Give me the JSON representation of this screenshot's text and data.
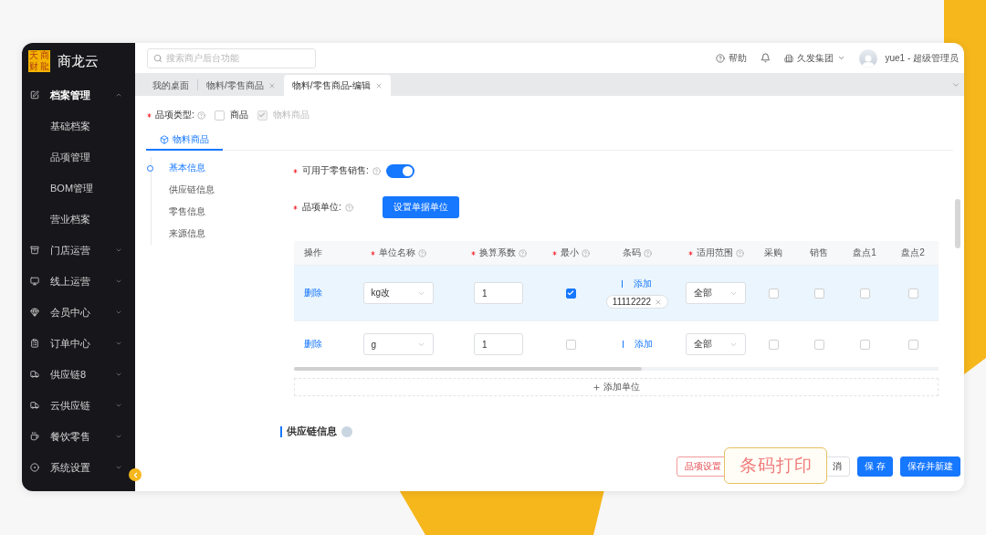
{
  "sidebar": {
    "logo": {
      "chars": [
        "天",
        "商",
        "财",
        "龍"
      ],
      "name": "商龙云"
    },
    "items": [
      {
        "label": "档案管理",
        "expanded": true,
        "children": [
          {
            "label": "基础档案"
          },
          {
            "label": "品项管理"
          },
          {
            "label": "BOM管理"
          },
          {
            "label": "营业档案"
          }
        ]
      },
      {
        "label": "门店运营",
        "expanded": false
      },
      {
        "label": "线上运营",
        "expanded": false
      },
      {
        "label": "会员中心",
        "expanded": false
      },
      {
        "label": "订单中心",
        "expanded": false
      },
      {
        "label": "供应链8",
        "expanded": false
      },
      {
        "label": "云供应链",
        "expanded": false
      },
      {
        "label": "餐饮零售",
        "expanded": false
      },
      {
        "label": "系统设置",
        "expanded": false
      }
    ]
  },
  "topbar": {
    "search": {
      "placeholder": "搜索商户后台功能"
    },
    "help": "帮助",
    "organization": "久发集团",
    "user": "yue1 - 超级管理员"
  },
  "tabs": [
    {
      "label": "我的桌面",
      "closable": false,
      "selected": false
    },
    {
      "label": "物料/零售商品",
      "closable": true,
      "selected": false
    },
    {
      "label": "物料/零售商品-编辑",
      "closable": true,
      "selected": true
    }
  ],
  "item_type": {
    "label": "品项类型:",
    "required": true,
    "options": [
      {
        "label": "商品",
        "checked": false,
        "disabled": false
      },
      {
        "label": "物料商品",
        "checked": true,
        "disabled": true
      }
    ]
  },
  "section_tabs": [
    {
      "label": "物料商品",
      "selected": true
    }
  ],
  "anchors": [
    {
      "label": "基本信息",
      "selected": true
    },
    {
      "label": "供应链信息",
      "selected": false
    },
    {
      "label": "零售信息",
      "selected": false
    },
    {
      "label": "来源信息",
      "selected": false
    }
  ],
  "retail_sale": {
    "label": "可用于零售销售:",
    "required": true,
    "on": true
  },
  "unit": {
    "label": "品项单位:",
    "required": true,
    "button": "设置单据单位"
  },
  "units_table": {
    "columns": [
      {
        "label": "操作",
        "required": false,
        "help": false
      },
      {
        "label": "单位名称",
        "required": true,
        "help": true
      },
      {
        "label": "换算系数",
        "required": true,
        "help": true
      },
      {
        "label": "最小",
        "required": true,
        "help": true
      },
      {
        "label": "条码",
        "required": false,
        "help": true
      },
      {
        "label": "适用范围",
        "required": true,
        "help": true
      },
      {
        "label": "采购",
        "required": false,
        "help": false
      },
      {
        "label": "销售",
        "required": false,
        "help": false
      },
      {
        "label": "盘点1",
        "required": false,
        "help": false
      },
      {
        "label": "盘点2",
        "required": false,
        "help": false
      }
    ],
    "rows": [
      {
        "selected": true,
        "action": "删除",
        "unit": "kg改",
        "factor": "1",
        "smallest": true,
        "barcode_link": "添加",
        "barcodes": [
          "11112222"
        ],
        "scope": "全部",
        "purchase": false,
        "sale": false,
        "stocktake1": false,
        "stocktake2": false
      },
      {
        "selected": false,
        "action": "删除",
        "unit": "g",
        "factor": "1",
        "smallest": false,
        "barcode_link": "添加",
        "scope": "全部",
        "purchase": false,
        "sale": false,
        "stocktake1": false,
        "stocktake2": false
      }
    ],
    "add_button": "添加单位"
  },
  "supply_chain_section": {
    "title": "供应链信息"
  },
  "footer_buttons": [
    {
      "label": "品项设置",
      "kind": "danger"
    },
    {
      "label": "消",
      "kind": "default"
    },
    {
      "label": "保 存",
      "kind": "primary"
    },
    {
      "label": "保存并新建",
      "kind": "primary"
    }
  ],
  "callout": {
    "label": "条码打印"
  }
}
